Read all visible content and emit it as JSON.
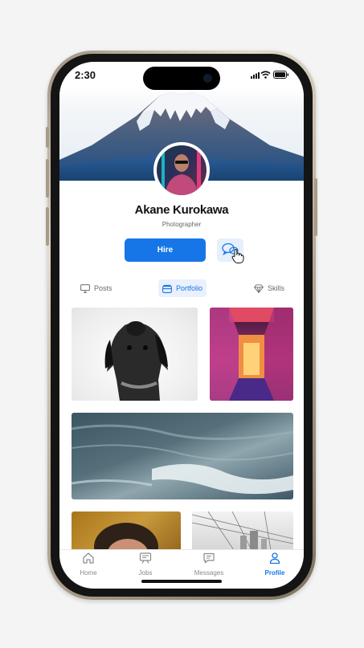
{
  "status_bar": {
    "time": "2:30"
  },
  "profile": {
    "name": "Akane Kurokawa",
    "role": "Photographer",
    "hire_label": "Hire"
  },
  "tabs": [
    {
      "label": "Posts",
      "icon": "monitor-icon",
      "active": false
    },
    {
      "label": "Portfolio",
      "icon": "folder-icon",
      "active": true
    },
    {
      "label": "Skills",
      "icon": "diamond-icon",
      "active": false
    }
  ],
  "nav": [
    {
      "label": "Home",
      "icon": "home-icon",
      "active": false
    },
    {
      "label": "Jobs",
      "icon": "jobs-icon",
      "active": false
    },
    {
      "label": "Messages",
      "icon": "message-icon",
      "active": false
    },
    {
      "label": "Profile",
      "icon": "user-icon",
      "active": true
    }
  ],
  "colors": {
    "accent": "#1676e8",
    "accent_soft": "#eaf1fd"
  }
}
